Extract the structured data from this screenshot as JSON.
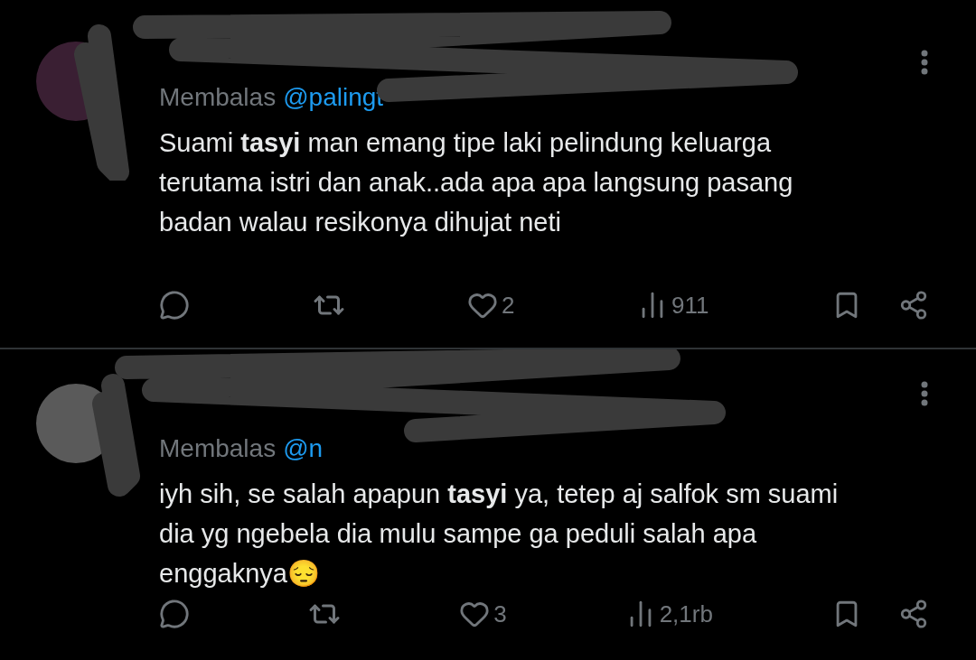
{
  "tweets": [
    {
      "replying_label": "Membalas",
      "replying_handle": "@palingt",
      "lines": [
        "Suami **tasyi** man emang tipe laki pelindung keluarga",
        "terutama istri dan anak..ada apa apa langsung pasang",
        "badan walau resikonya dihujat neti"
      ],
      "likes": "2",
      "views": "911"
    },
    {
      "replying_label": "Membalas",
      "replying_handle": "@n",
      "lines": [
        "iyh sih, se salah apapun **tasyi** ya, tetep aj salfok sm suami",
        "dia yg ngebela dia mulu sampe ga peduli salah apa",
        "enggaknya😔"
      ],
      "likes": "3",
      "views": "2,1rb"
    }
  ]
}
